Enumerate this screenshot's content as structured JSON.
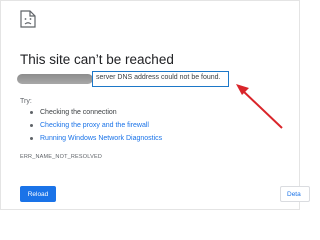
{
  "page": {
    "title": "This site can’t be reached",
    "error_message": "server DNS address could not be found.",
    "try_label": "Try:",
    "suggestions": [
      {
        "text": "Checking the connection",
        "is_link": false
      },
      {
        "text": "Checking the proxy and the firewall",
        "is_link": true
      },
      {
        "text": "Running Windows Network Diagnostics",
        "is_link": true
      }
    ],
    "error_code": "ERR_NAME_NOT_RESOLVED",
    "reload_label": "Reload",
    "details_label": "Deta"
  },
  "icons": {
    "sad_document": "sad-document-icon",
    "annotation_arrow": "red-arrow-annotation"
  },
  "colors": {
    "accent_blue": "#1a73e8",
    "highlight_blue": "#1d78c8",
    "annotation_red": "#d9252a"
  }
}
